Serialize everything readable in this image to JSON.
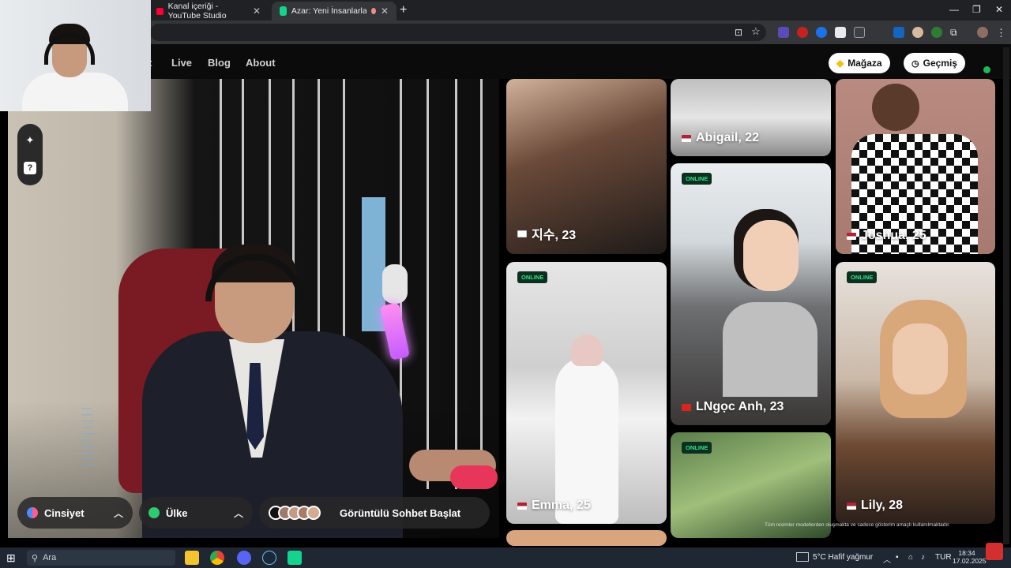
{
  "browser": {
    "tabs": [
      {
        "title": "Kanal içeriği - YouTube Studio"
      },
      {
        "title": "Azar: Yeni İnsanlarla Görün"
      }
    ]
  },
  "site": {
    "nav": [
      "t",
      "Live",
      "Blog",
      "About"
    ],
    "shop_label": "Mağaza",
    "history_label": "Geçmiş"
  },
  "controls": {
    "gender_label": "Cinsiyet",
    "country_label": "Ülke",
    "start_label": "Görüntülü Sohbet Başlat"
  },
  "profiles": [
    {
      "name": "지수, 23",
      "flag": "kr",
      "online": false
    },
    {
      "name": "Abigail, 22",
      "flag": "us",
      "online": false
    },
    {
      "name": "Joshua, 25",
      "flag": "us",
      "online": false
    },
    {
      "name": "LNgọc Anh, 23",
      "flag": "vn",
      "online": true
    },
    {
      "name": "Emma, 25",
      "flag": "us",
      "online": true
    },
    {
      "name": "Lily, 28",
      "flag": "us",
      "online": true
    },
    {
      "name": "",
      "flag": "",
      "online": true
    }
  ],
  "online_badge": "ONLINE",
  "disclaimer": "Tüm resimler modellerden oluşmakta ve sadece gösterim amaçlı kullanılmaktadır.",
  "taskbar": {
    "search_placeholder": "Ara",
    "weather": "5°C  Hafif yağmur",
    "language": "TUR",
    "time": "18:34",
    "date": "17.02.2025"
  },
  "colors": {
    "online_green": "#35e08a",
    "brand_bg": "#0b0b0b"
  }
}
